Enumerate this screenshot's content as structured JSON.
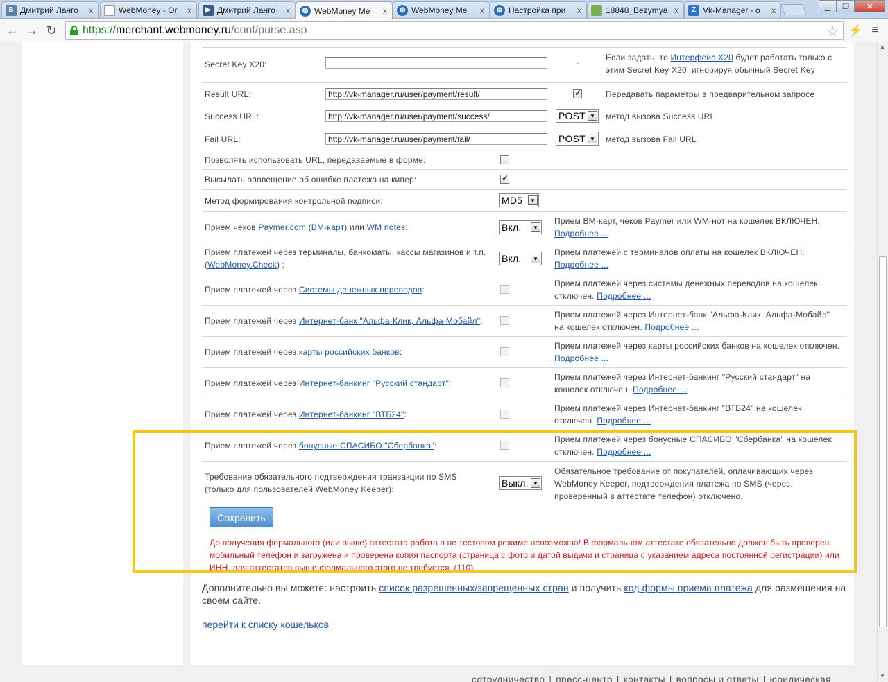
{
  "browser": {
    "tabs": [
      {
        "title": "Дмитрий Ланго",
        "favicon": "vk-icon"
      },
      {
        "title": "WebMoney - Ог",
        "favicon": "document-icon"
      },
      {
        "title": "Дмитрий Ланго",
        "favicon": "video-icon"
      },
      {
        "title": "WebMoney Me",
        "favicon": "webmoney-icon",
        "active": true
      },
      {
        "title": "WebMoney Me",
        "favicon": "webmoney-icon"
      },
      {
        "title": "Настройка при",
        "favicon": "webmoney-icon"
      },
      {
        "title": "18848_Bezymya",
        "favicon": "image-icon"
      },
      {
        "title": "Vk-Manager - о",
        "favicon": "vkmanager-icon"
      }
    ],
    "tab_close_glyph": "x",
    "url": {
      "scheme": "https://",
      "host": "merchant.webmoney.ru",
      "path": "/conf/purse.asp"
    }
  },
  "form": {
    "secret_key": {
      "label": "Secret Key X20:",
      "value": "",
      "dash": "-",
      "desc_pre": "Если задать, то ",
      "desc_link": "Интерфейс X20",
      "desc_post": " будет работать только с этим Secret Key X20, игнорируя обычный Secret Key"
    },
    "result_url": {
      "label": "Result URL:",
      "value": "http://vk-manager.ru/user/payment/result/",
      "desc": "Передавать параметры в предварительном запросе",
      "checked": true
    },
    "success_url": {
      "label": "Success URL:",
      "value": "http://vk-manager.ru/user/payment/success/",
      "method": "POST",
      "desc": "метод вызова Success URL"
    },
    "fail_url": {
      "label": "Fail URL:",
      "value": "http://vk-manager.ru/user/payment/fail/",
      "method": "POST",
      "desc": "метод вызова Fail URL"
    },
    "allow_form_urls": {
      "label": "Позволять использовать URL, передаваемые в форме:",
      "checked": false
    },
    "notify_keeper": {
      "label": "Высылать оповещение об ошибке платежа на кипер:",
      "checked": true
    },
    "signature_method": {
      "label": "Метод формирования контрольной подписи:",
      "value": "MD5"
    },
    "paymer": {
      "label_pre": "Прием чеков ",
      "link1": "Paymer.com",
      "mid1": " (",
      "link2": "ВМ-карт",
      "mid2": ") или ",
      "link3": "WM notes",
      "post": ":",
      "value": "Вкл.",
      "desc": "Прием ВМ-карт, чеков Paymer или WM-нот на кошелек ВКЛЮЧЕН.",
      "more": "Подробнее ..."
    },
    "terminals": {
      "label_line1": "Прием платежей через терминалы, банкоматы, кассы магазинов и т.п.",
      "label_pre": "(",
      "label_link": "WebMoney.Check",
      "label_post": ") :",
      "value": "Вкл.",
      "desc": "Прием платежей с терминалов оплаты на кошелек ВКЛЮЧЕН.",
      "more": "Подробнее ..."
    },
    "prefix": "Прием платежей через ",
    "channels": [
      {
        "link": "Системы денежных переводов",
        "desc": "Прием платежей через системы денежных переводов на кошелек отключен.",
        "more": "Подробнее ..."
      },
      {
        "link": "Интернет-банк \"Альфа-Клик, Альфа-Мобайл\"",
        "desc": "Прием платежей через Интернет-банк \"Альфа-Клик, Альфа-Мобайл\" на кошелек отключен.",
        "more": "Подробнее ..."
      },
      {
        "link": "карты российских банков",
        "desc": "Прием платежей через карты российских банков на кошелек отключен.",
        "more": "Подробнее ..."
      },
      {
        "link": "Интернет-банкинг \"Русский стандарт\"",
        "desc": "Прием платежей через Интернет-банкинг \"Русский стандарт\" на кошелек отключен.",
        "more": "Подробнее ..."
      },
      {
        "link": "Интернет-банкинг \"ВТБ24\"",
        "desc": "Прием платежей через Интернет-банкинг \"ВТБ24\" на кошелек отключен.",
        "more": "Подробнее ..."
      },
      {
        "link": "бонусные СПАСИБО \"Сбербанка\"",
        "desc": "Прием платежей через бонусные СПАСИБО \"Сбербанка\" на кошелек отключен.",
        "more": "Подробнее ..."
      }
    ],
    "sms": {
      "label_line1": "Требование обязательного подтверждения транзакции по SMS",
      "label_line2": "(только для пользователей WebMoney Keeper):",
      "value": "Выкл.",
      "desc": "Обязательное требование от покупателей, оплачивающих через WebMoney Keeper, подтверждения платежа по SMS (через проверенный в аттестате телефон) отключено."
    },
    "save_label": "Сохранить",
    "warning": "До получения формального (или выше) аттестата работа в не тестовом режиме невозможна! В формальном аттестате обязательно должен быть проверен мобильный телефон и загружена и проверена копия паспорта (страница с фото и датой выдачи и страница с указанием адреса постоянной регистрации) или ИНН, для аттестатов выше формального этого не требуется. (110)",
    "extra_pre": "Дополнительно вы можете: настроить ",
    "extra_link1": "список разрешенных/запрещенных стран",
    "extra_mid": " и получить ",
    "extra_link2": "код формы приема платежа",
    "extra_post": " для размещения на своем сайте.",
    "back_link": "перейти к списку кошельков"
  },
  "footer": [
    "сотрудничество",
    "пресс-центр",
    "контакты",
    "вопросы и ответы",
    "юридическая"
  ],
  "footer_separator": "|",
  "highlight_color": "#f5c518"
}
